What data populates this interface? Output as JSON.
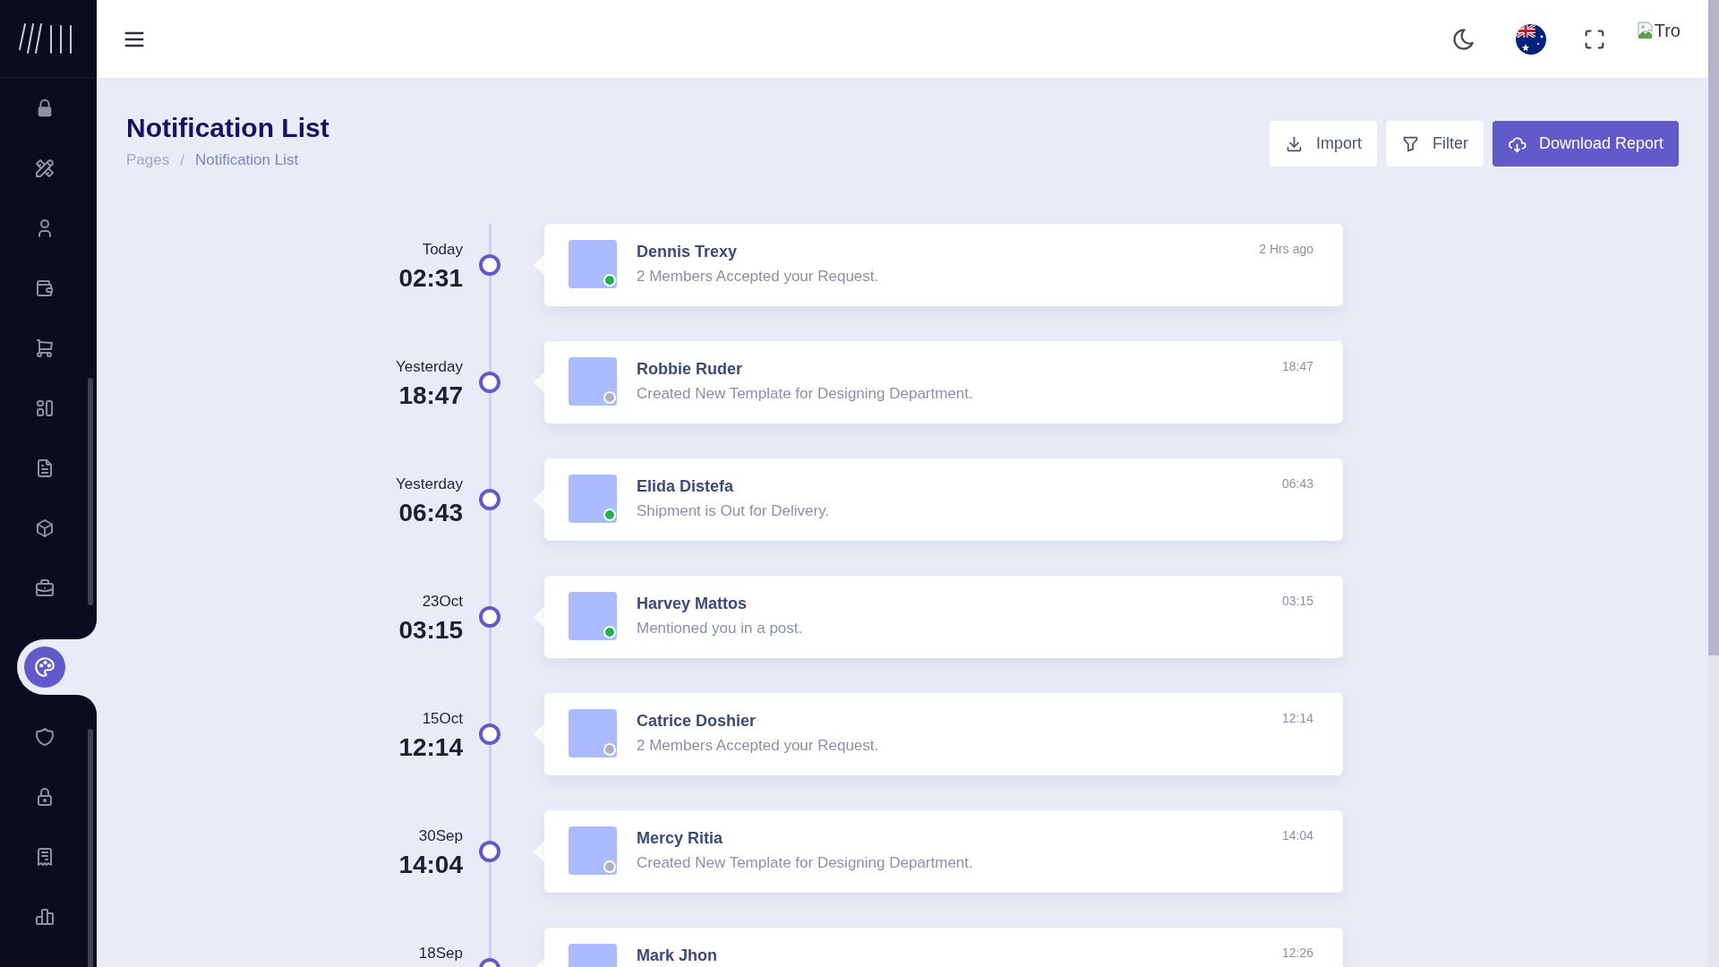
{
  "sidebar": {
    "items": [
      {
        "selected": false
      },
      {
        "selected": false
      },
      {
        "selected": false
      },
      {
        "selected": false
      },
      {
        "selected": false
      },
      {
        "selected": false
      },
      {
        "selected": false
      },
      {
        "selected": false
      },
      {
        "selected": false
      },
      {
        "selected": true
      },
      {
        "selected": false
      },
      {
        "selected": false
      },
      {
        "selected": false
      },
      {
        "selected": false
      }
    ]
  },
  "header": {
    "profile_image_alt": "Tro"
  },
  "page": {
    "title": "Notification List",
    "breadcrumb": {
      "items": [
        "Pages",
        "Notification List"
      ],
      "separator": "/"
    },
    "actions": [
      {
        "label": "Import",
        "kind": "default"
      },
      {
        "label": "Filter",
        "kind": "default"
      },
      {
        "label": "Download Report",
        "kind": "primary"
      }
    ]
  },
  "timeline": [
    {
      "day": "Today",
      "time": "02:31",
      "name": "Dennis Trexy",
      "message": "2 Members Accepted your Request.",
      "when": "2 Hrs ago",
      "online": true
    },
    {
      "day": "Yesterday",
      "time": "18:47",
      "name": "Robbie Ruder",
      "message": "Created New Template for Designing Department.",
      "when": "18:47",
      "online": false
    },
    {
      "day": "Yesterday",
      "time": "06:43",
      "name": "Elida Distefa",
      "message": "Shipment is Out for Delivery.",
      "when": "06:43",
      "online": true
    },
    {
      "day": "23Oct",
      "time": "03:15",
      "name": "Harvey Mattos",
      "message": "Mentioned you in a post.",
      "when": "03:15",
      "online": true
    },
    {
      "day": "15Oct",
      "time": "12:14",
      "name": "Catrice Doshier",
      "message": "2 Members Accepted your Request.",
      "when": "12:14",
      "online": false
    },
    {
      "day": "30Sep",
      "time": "14:04",
      "name": "Mercy Ritia",
      "message": "Created New Template for Designing Department.",
      "when": "14:04",
      "online": false
    },
    {
      "day": "18Sep",
      "name": "Mark Jhon",
      "when": "12:26"
    }
  ]
}
